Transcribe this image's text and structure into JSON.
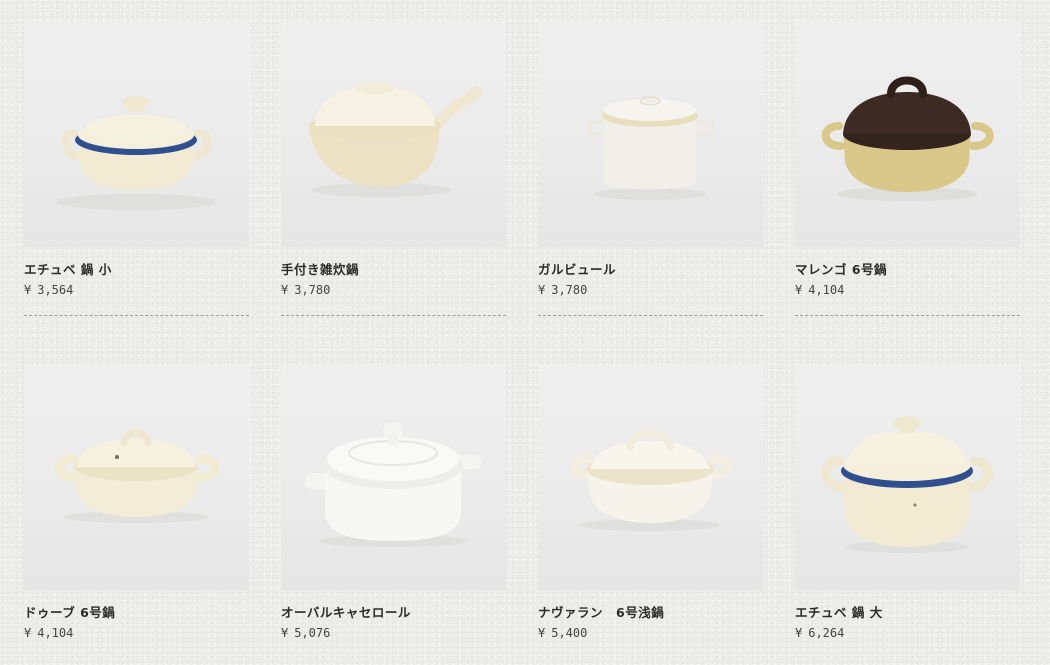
{
  "products": [
    {
      "name": "エチュベ 鍋 小",
      "currency": "¥",
      "price": "3,564",
      "icon": "pot-blue-band-small"
    },
    {
      "name": "手付き雑炊鍋",
      "currency": "¥",
      "price": "3,780",
      "icon": "pot-handled-zousui"
    },
    {
      "name": "ガルビュール",
      "currency": "¥",
      "price": "3,780",
      "icon": "pot-tall-white"
    },
    {
      "name": "マレンゴ 6号鍋",
      "currency": "¥",
      "price": "4,104",
      "icon": "pot-brown-lid"
    },
    {
      "name": "ドゥーブ 6号鍋",
      "currency": "¥",
      "price": "4,104",
      "icon": "pot-cream-round"
    },
    {
      "name": "オーバルキャセロール",
      "currency": "¥",
      "price": "5,076",
      "icon": "pot-white-oval"
    },
    {
      "name": "ナヴァラン　6号浅鍋",
      "currency": "¥",
      "price": "5,400",
      "icon": "pot-shallow-cream"
    },
    {
      "name": "エチュベ 鍋 大",
      "currency": "¥",
      "price": "6,264",
      "icon": "pot-blue-band-large"
    }
  ],
  "colors": {
    "background": "#eeeeec",
    "photo_background": "#ebebeb",
    "cream": "#f2ead3",
    "blue_band": "#2f4f8f",
    "brown_lid": "#3d2a22",
    "mustard": "#d9c88a",
    "text": "#2b2b2b"
  }
}
